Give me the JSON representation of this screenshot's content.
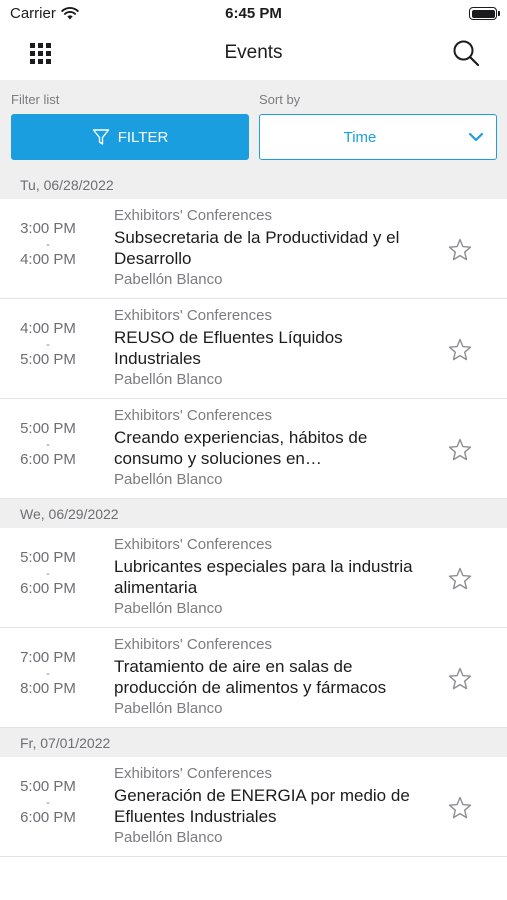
{
  "status_bar": {
    "carrier": "Carrier",
    "time": "6:45 PM"
  },
  "nav": {
    "title": "Events",
    "menu_icon": "grid-icon",
    "search_icon": "search-icon"
  },
  "filters": {
    "filter_label": "Filter list",
    "filter_button": "FILTER",
    "sort_label": "Sort by",
    "sort_value": "Time"
  },
  "colors": {
    "accent": "#1b9ee0",
    "section_bg": "#efeff0"
  },
  "days": [
    {
      "date": "Tu, 06/28/2022",
      "events": [
        {
          "start": "3:00 PM",
          "sep": "-",
          "end": "4:00 PM",
          "category": "Exhibitors' Conferences",
          "title": "Subsecretaria de la Productividad y el Desarrollo",
          "location": "Pabellón Blanco"
        },
        {
          "start": "4:00 PM",
          "sep": "-",
          "end": "5:00 PM",
          "category": "Exhibitors' Conferences",
          "title": "REUSO de Efluentes Líquidos Industriales",
          "location": "Pabellón Blanco"
        },
        {
          "start": "5:00 PM",
          "sep": "-",
          "end": "6:00 PM",
          "category": "Exhibitors' Conferences",
          "title": "Creando experiencias, hábitos de consumo y soluciones en…",
          "location": "Pabellón Blanco"
        }
      ]
    },
    {
      "date": "We, 06/29/2022",
      "events": [
        {
          "start": "5:00 PM",
          "sep": "-",
          "end": "6:00 PM",
          "category": "Exhibitors' Conferences",
          "title": "Lubricantes especiales para la industria alimentaria",
          "location": "Pabellón Blanco"
        },
        {
          "start": "7:00 PM",
          "sep": "-",
          "end": "8:00 PM",
          "category": "Exhibitors' Conferences",
          "title": "Tratamiento de aire en salas de producción de alimentos y fármacos",
          "location": "Pabellón Blanco"
        }
      ]
    },
    {
      "date": "Fr, 07/01/2022",
      "events": [
        {
          "start": "5:00 PM",
          "sep": "-",
          "end": "6:00 PM",
          "category": "Exhibitors' Conferences",
          "title": "Generación de ENERGIA por medio de Efluentes Industriales",
          "location": "Pabellón Blanco"
        }
      ]
    }
  ]
}
